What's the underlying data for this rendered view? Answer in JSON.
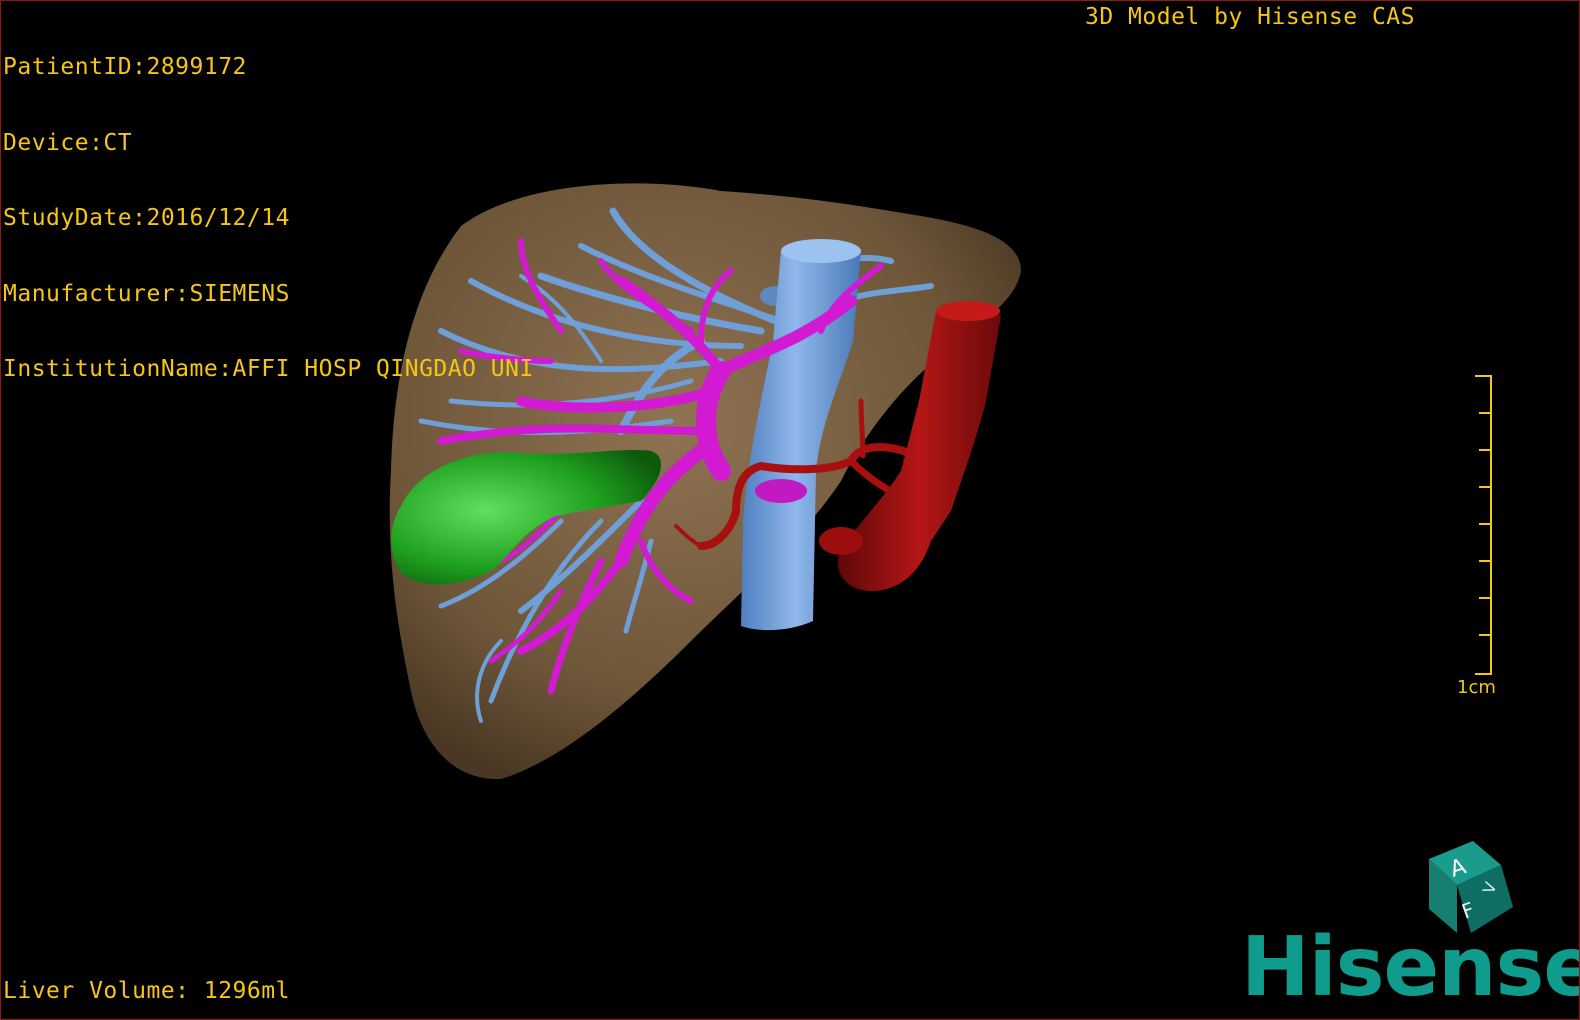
{
  "header": {
    "patient_id": "PatientID:2899172",
    "device": "Device:CT",
    "study_date": "StudyDate:2016/12/14",
    "manufacturer": "Manufacturer:SIEMENS",
    "institution": "InstitutionName:AFFI HOSP QINGDAO UNI"
  },
  "watermark_title": "3D Model by Hisense CAS",
  "liver_volume": "Liver Volume: 1296ml",
  "scale": {
    "label": "1cm"
  },
  "orientation_cube": {
    "face_a": "A",
    "face_f": "F",
    "face_side": "V"
  },
  "brand": "Hisense",
  "colors": {
    "overlay_text": "#f5c518",
    "liver": "#7d6446",
    "hepatic_vein": "#6f9fd8",
    "portal_vein": "#d21ad2",
    "artery_ivc": "#a81010",
    "tumor": "#1ea51e",
    "brand": "#0f9c8c"
  }
}
